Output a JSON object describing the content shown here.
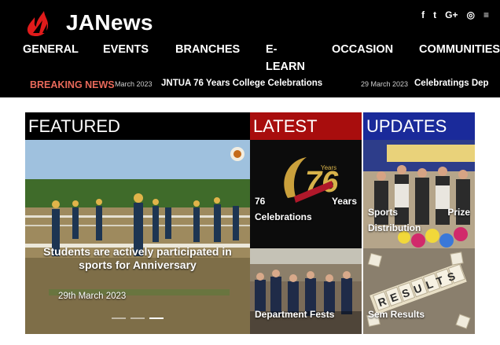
{
  "site": {
    "name": "JANews",
    "brand_color": "#e01b1b"
  },
  "social": {
    "icons": [
      "facebook-icon",
      "twitter-icon",
      "google-plus-icon",
      "instagram-icon",
      "rss-icon"
    ],
    "glyphs": [
      "f",
      "t",
      "G+",
      "◎",
      "≡"
    ]
  },
  "nav": {
    "items": [
      "GENERAL",
      "EVENTS",
      "BRANCHES",
      "E-LEARN",
      "OCCASION",
      "COMMUNITIES"
    ]
  },
  "ticker": {
    "label": "BREAKING NEWS",
    "items": [
      {
        "date": "March 2023",
        "title": "JNTUA 76 Years College Celebrations"
      },
      {
        "date": "29 March 2023",
        "title": "Celebratings Dep"
      }
    ]
  },
  "sections": {
    "featured": "FEATURED",
    "latest": "LATEST",
    "updates": "UPDATES"
  },
  "featured_card": {
    "headline": "Students are actively participated in sports for Anniversary",
    "date": "29th March 2023"
  },
  "latest_cards": [
    {
      "title_left": "76",
      "title_right": "Years",
      "title_line2": "Celebrations",
      "badge_text": "76"
    },
    {
      "title": "Department Fests"
    }
  ],
  "updates_cards": [
    {
      "title_left": "Sports",
      "title_right": "Prize",
      "title_line2": "Distribution"
    },
    {
      "title": "Sem Results",
      "tiles": "RESULTS"
    }
  ],
  "colors": {
    "latest_bg": "#a80d0d",
    "updates_bg": "#1a2a9a",
    "breaking": "#e8695a"
  }
}
